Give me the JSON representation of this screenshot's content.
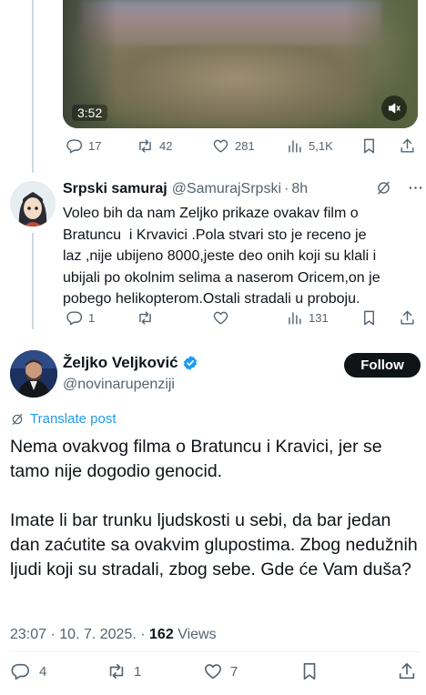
{
  "prev_tweet": {
    "video_duration": "3:52",
    "replies": "17",
    "reposts": "42",
    "likes": "281",
    "views": "5,1K"
  },
  "reply": {
    "display_name": "Srpski samuraj",
    "handle": "@SamurajSrpski",
    "separator": "·",
    "time": "8h",
    "lines": [
      "Voleo bih da nam Zeljko prikaze ovakav film o",
      "Bratuncu  i Krvavici .Pola stvari sto je receno je",
      "laz ,nije ubijeno 8000,jeste deo onih koji su klali i",
      "ubijali po okolnim selima a naserom Oricem,on je",
      "pobego helikopterom.Ostali stradali u proboju."
    ],
    "replies": "1",
    "views": "131"
  },
  "main_tweet": {
    "display_name": "Željko Veljković",
    "handle": "@novinarupenziji",
    "follow_label": "Follow",
    "translate_label": "Translate post",
    "paragraph1": "Nema ovakvog filma o Bratuncu i Kravici, jer se tamo nije dogodio genocid.",
    "paragraph2": "Imate li bar trunku ljudskosti u sebi, da bar jedan dan zaćutite sa ovakvim glupostima. Zbog nedužnih ljudi koji su stradali, zbog sebe. Gde će Vam duša?",
    "time": "23:07",
    "date": "10. 7. 2025.",
    "dot": "·",
    "views_count": "162",
    "views_label": "Views",
    "replies": "4",
    "reposts": "1",
    "likes": "7"
  },
  "colors": {
    "text": "#0f1419",
    "secondary": "#536471",
    "link": "#1d9bf0",
    "verified": "#1d9bf0",
    "thread_line": "#cfd9de"
  },
  "icons": [
    "reply-icon",
    "repost-icon",
    "like-icon",
    "views-icon",
    "bookmark-icon",
    "share-icon",
    "grok-icon",
    "more-icon",
    "mute-icon",
    "verified-badge-icon",
    "translate-icon"
  ]
}
